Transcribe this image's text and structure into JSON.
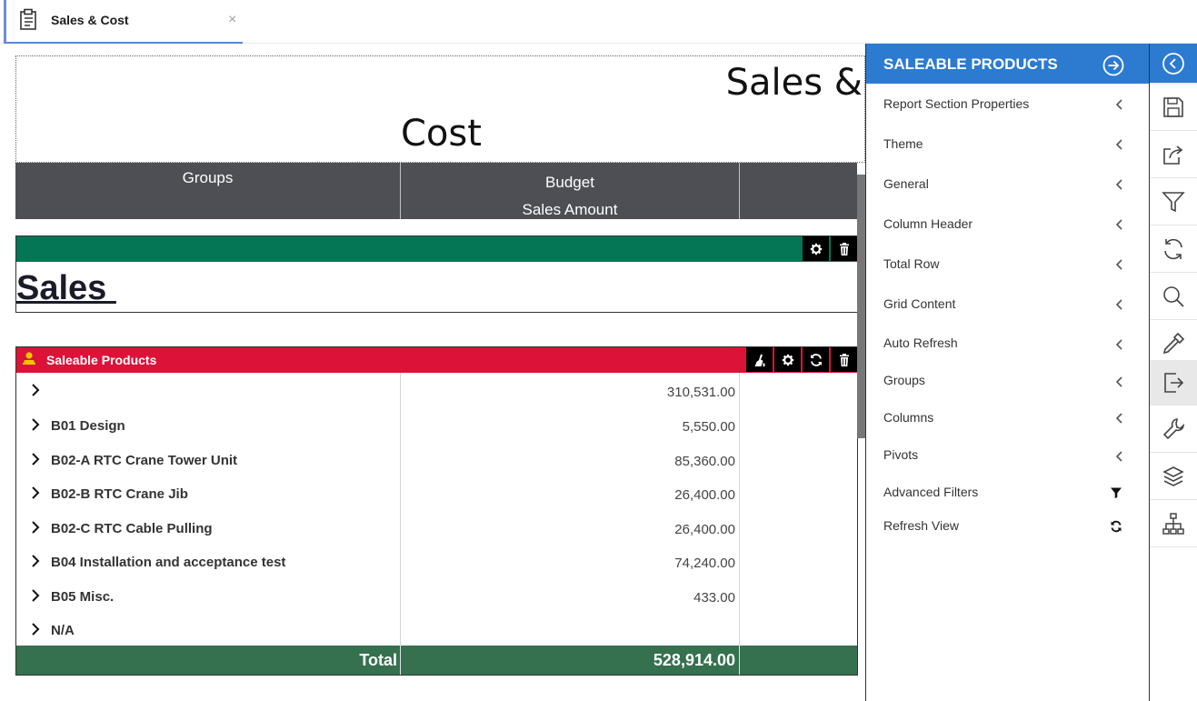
{
  "tab": {
    "label": "Sales & Cost",
    "close": "×"
  },
  "report": {
    "title_line1": "Sales &",
    "title_line2": "Cost",
    "columns": {
      "groups": "Groups",
      "budget": "Budget",
      "sales_amount": "Sales Amount"
    },
    "sales_section": {
      "title": "Sales "
    },
    "grid": {
      "title": "Saleable Products",
      "rows": [
        {
          "group": "",
          "amount": "310,531.00"
        },
        {
          "group": "B01 Design",
          "amount": "5,550.00"
        },
        {
          "group": "B02-A RTC Crane Tower Unit",
          "amount": "85,360.00"
        },
        {
          "group": "B02-B RTC Crane Jib",
          "amount": "26,400.00"
        },
        {
          "group": "B02-C RTC Cable Pulling",
          "amount": "26,400.00"
        },
        {
          "group": "B04 Installation and acceptance test",
          "amount": "74,240.00"
        },
        {
          "group": "B05 Misc.",
          "amount": "433.00"
        },
        {
          "group": "N/A",
          "amount": ""
        }
      ],
      "total": {
        "label": "Total",
        "amount": "528,914.00"
      }
    }
  },
  "panel": {
    "title": "SALEABLE PRODUCTS",
    "items": [
      {
        "label": "Report Section Properties",
        "icon": "chevron-left-icon"
      },
      {
        "label": "Theme",
        "icon": "chevron-left-icon"
      },
      {
        "label": "General",
        "icon": "chevron-left-icon"
      },
      {
        "label": "Column Header",
        "icon": "chevron-left-icon"
      },
      {
        "label": "Total Row",
        "icon": "chevron-left-icon"
      },
      {
        "label": "Grid Content",
        "icon": "chevron-left-icon"
      },
      {
        "label": "Auto Refresh",
        "icon": "chevron-left-icon"
      },
      {
        "label": "Groups",
        "icon": "chevron-left-icon"
      },
      {
        "label": "Columns",
        "icon": "chevron-left-icon"
      },
      {
        "label": "Pivots",
        "icon": "chevron-left-icon"
      },
      {
        "label": "Advanced Filters",
        "icon": "filter-icon"
      },
      {
        "label": "Refresh View",
        "icon": "refresh-icon"
      }
    ]
  },
  "rail": [
    "back-icon",
    "save-icon",
    "share-icon",
    "filter-icon",
    "refresh-icon",
    "search-icon",
    "eyedropper-icon",
    "exit-icon",
    "wrench-icon",
    "layers-icon",
    "hierarchy-icon"
  ],
  "colors": {
    "accent": "#2c7bd1",
    "sales_bar": "#047555",
    "grid_bar": "#dc1239",
    "header": "#4e4f54",
    "total": "#35704f"
  }
}
